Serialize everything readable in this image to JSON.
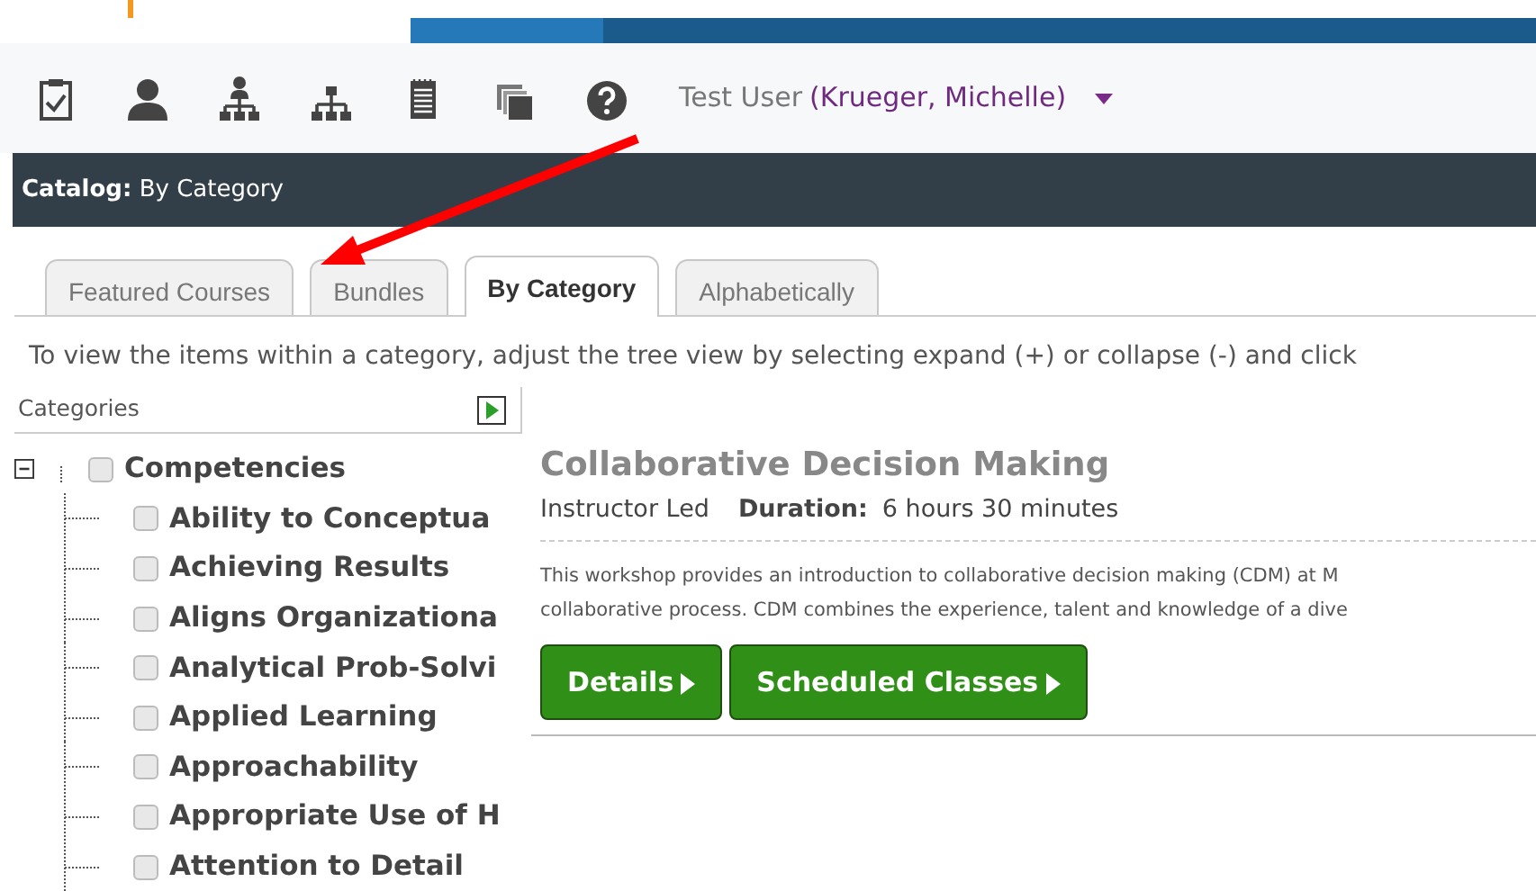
{
  "toolbar": {
    "icons": [
      {
        "kind": "clipboard"
      },
      {
        "kind": "user"
      },
      {
        "kind": "org-user"
      },
      {
        "kind": "org"
      },
      {
        "kind": "notepad"
      },
      {
        "kind": "copies"
      },
      {
        "kind": "help"
      }
    ],
    "user_label": "Test User",
    "user_name": "(Krueger, Michelle)"
  },
  "header": {
    "label": "Catalog:",
    "title": "By Category"
  },
  "tabs": [
    {
      "label": "Featured Courses",
      "selected": false
    },
    {
      "label": "Bundles",
      "selected": false
    },
    {
      "label": "By Category",
      "selected": true
    },
    {
      "label": "Alphabetically",
      "selected": false
    }
  ],
  "instructions": "To view the items within a category, adjust the tree view by selecting expand (+) or collapse (-) and click",
  "categories": {
    "title": "Categories",
    "tree": [
      {
        "label": "Competencies",
        "checked": false,
        "expanded": true,
        "children": [
          {
            "label": "Ability to Conceptua",
            "checked": false
          },
          {
            "label": "Achieving Results",
            "checked": false
          },
          {
            "label": "Aligns Organizationa",
            "checked": false
          },
          {
            "label": "Analytical Prob-Solvi",
            "checked": false
          },
          {
            "label": "Applied Learning",
            "checked": false
          },
          {
            "label": "Approachability",
            "checked": false
          },
          {
            "label": "Appropriate Use of H",
            "checked": false
          },
          {
            "label": "Attention to Detail",
            "checked": false
          }
        ]
      }
    ]
  },
  "course": {
    "title": "Collaborative Decision Making",
    "type": "Instructor Led",
    "duration_label": "Duration:",
    "duration": "6 hours 30 minutes",
    "description": [
      "This workshop provides an introduction to collaborative decision making (CDM) at M",
      "collaborative process. CDM combines the experience, talent and knowledge of a dive"
    ],
    "buttons": [
      "Details",
      "Scheduled Classes"
    ]
  },
  "overlay": {
    "kind": "arrow"
  }
}
